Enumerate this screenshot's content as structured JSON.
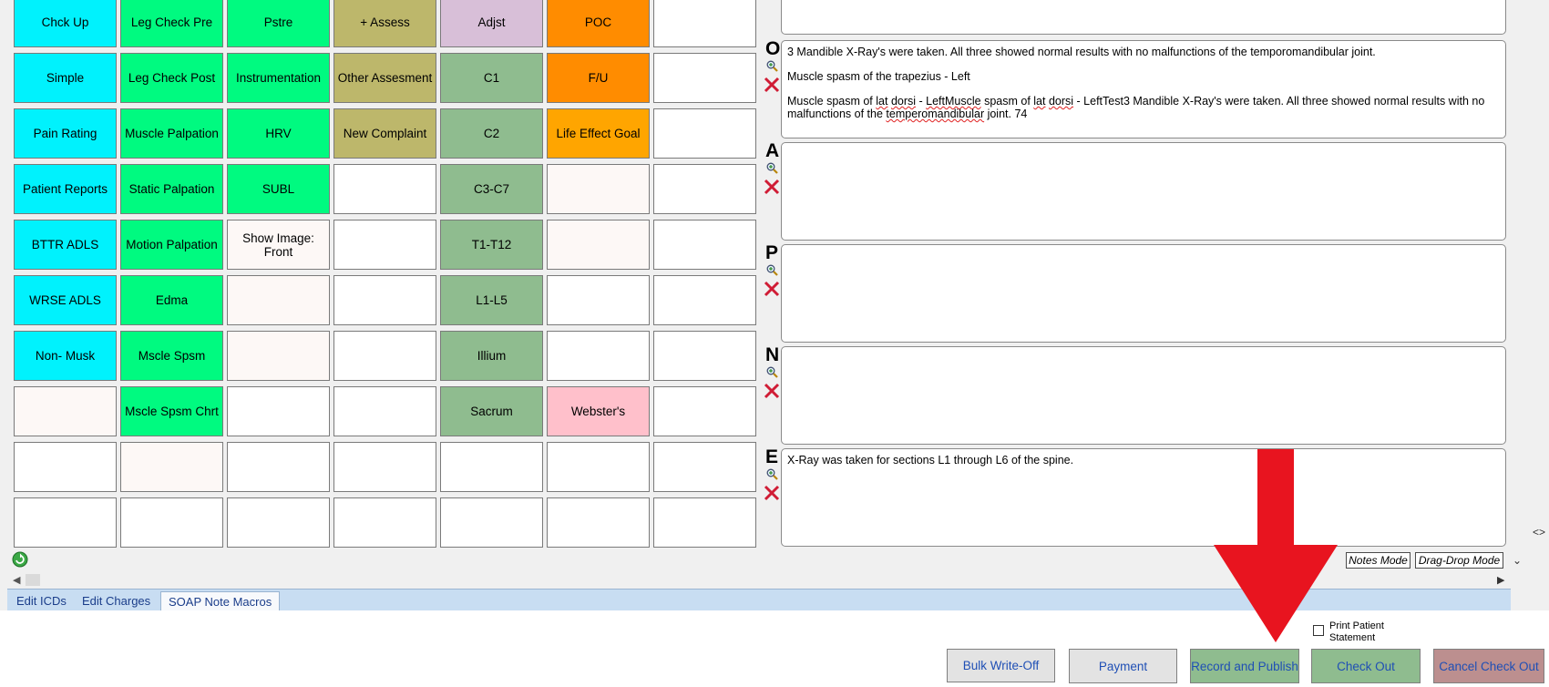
{
  "macro_grid": {
    "rows": [
      [
        {
          "label": "Chck Up",
          "color": "cyan"
        },
        {
          "label": "Leg Check Pre",
          "color": "green"
        },
        {
          "label": "Pstre",
          "color": "green"
        },
        {
          "label": "+ Assess",
          "color": "olive"
        },
        {
          "label": "Adjst",
          "color": "lilac"
        },
        {
          "label": "POC",
          "color": "orange"
        },
        {
          "label": "",
          "color": "white"
        }
      ],
      [
        {
          "label": "Simple",
          "color": "cyan"
        },
        {
          "label": "Leg Check Post",
          "color": "green"
        },
        {
          "label": "Instrumentation",
          "color": "green"
        },
        {
          "label": "Other Assesment",
          "color": "olive"
        },
        {
          "label": "C1",
          "color": "sage"
        },
        {
          "label": "F/U",
          "color": "orange"
        },
        {
          "label": "",
          "color": "white"
        }
      ],
      [
        {
          "label": "Pain Rating",
          "color": "cyan"
        },
        {
          "label": "Muscle Palpation",
          "color": "green"
        },
        {
          "label": "HRV",
          "color": "green"
        },
        {
          "label": "New Complaint",
          "color": "olive"
        },
        {
          "label": "C2",
          "color": "sage"
        },
        {
          "label": "Life Effect Goal",
          "color": "amber"
        },
        {
          "label": "",
          "color": "white"
        }
      ],
      [
        {
          "label": "Patient Reports",
          "color": "cyan"
        },
        {
          "label": "Static Palpation",
          "color": "green"
        },
        {
          "label": "SUBL",
          "color": "green"
        },
        {
          "label": "",
          "color": "white"
        },
        {
          "label": "C3-C7",
          "color": "sage"
        },
        {
          "label": "",
          "color": "snow"
        },
        {
          "label": "",
          "color": "white"
        }
      ],
      [
        {
          "label": "BTTR ADLS",
          "color": "cyan"
        },
        {
          "label": "Motion Palpation",
          "color": "green"
        },
        {
          "label": "Show Image: Front",
          "color": "snow"
        },
        {
          "label": "",
          "color": "white"
        },
        {
          "label": "T1-T12",
          "color": "sage"
        },
        {
          "label": "",
          "color": "snow"
        },
        {
          "label": "",
          "color": "white"
        }
      ],
      [
        {
          "label": "WRSE ADLS",
          "color": "cyan"
        },
        {
          "label": "Edma",
          "color": "green"
        },
        {
          "label": "",
          "color": "snow"
        },
        {
          "label": "",
          "color": "white"
        },
        {
          "label": "L1-L5",
          "color": "sage"
        },
        {
          "label": "",
          "color": "white"
        },
        {
          "label": "",
          "color": "white"
        }
      ],
      [
        {
          "label": "Non- Musk",
          "color": "cyan"
        },
        {
          "label": "Mscle Spsm",
          "color": "green"
        },
        {
          "label": "",
          "color": "snow"
        },
        {
          "label": "",
          "color": "white"
        },
        {
          "label": "Illium",
          "color": "sage"
        },
        {
          "label": "",
          "color": "white"
        },
        {
          "label": "",
          "color": "white"
        }
      ],
      [
        {
          "label": "",
          "color": "snow"
        },
        {
          "label": "Mscle Spsm Chrt",
          "color": "green"
        },
        {
          "label": "",
          "color": "white"
        },
        {
          "label": "",
          "color": "white"
        },
        {
          "label": "Sacrum",
          "color": "sage"
        },
        {
          "label": "Webster's",
          "color": "pink"
        },
        {
          "label": "",
          "color": "white"
        }
      ],
      [
        {
          "label": "",
          "color": "white"
        },
        {
          "label": "",
          "color": "snow"
        },
        {
          "label": "",
          "color": "white"
        },
        {
          "label": "",
          "color": "white"
        },
        {
          "label": "",
          "color": "white"
        },
        {
          "label": "",
          "color": "white"
        },
        {
          "label": "",
          "color": "white"
        }
      ],
      [
        {
          "label": "",
          "color": "white"
        },
        {
          "label": "",
          "color": "white"
        },
        {
          "label": "",
          "color": "white"
        },
        {
          "label": "",
          "color": "white"
        },
        {
          "label": "",
          "color": "white"
        },
        {
          "label": "",
          "color": "white"
        },
        {
          "label": "",
          "color": "white"
        }
      ]
    ]
  },
  "soap": {
    "o": {
      "letter": "O",
      "line1": "3 Mandible X-Ray's were taken. All three showed normal results with no malfunctions of the temporomandibular joint.",
      "line2": "Muscle spasm of the trapezius - Left",
      "line3_a": "Muscle spasm of ",
      "line3_b": "lat",
      "line3_c": " ",
      "line3_d": "dorsi",
      "line3_e": " - ",
      "line3_f": "LeftMuscle",
      "line3_g": " spasm of ",
      "line3_h": "lat",
      "line3_i": " ",
      "line3_j": "dorsi",
      "line3_k": " - LeftTest3 Mandible X-Ray's were taken. All three showed normal results with no malfunctions of the ",
      "line3_l": "temperomandibular",
      "line3_m": " joint. 74"
    },
    "a": {
      "letter": "A"
    },
    "p": {
      "letter": "P"
    },
    "n": {
      "letter": "N"
    },
    "e": {
      "letter": "E",
      "text": "X-Ray was taken for sections L1 through L6 of the spine."
    }
  },
  "mode_buttons": {
    "notes": "Notes Mode",
    "drag_drop": "Drag-Drop Mode"
  },
  "tabs": {
    "edit_icds": "Edit ICDs",
    "edit_charges": "Edit Charges",
    "soap_note_macros": "SOAP Note Macros"
  },
  "print_statement": {
    "label_line1": "Print Patient",
    "label_line2": "Statement",
    "checked": false
  },
  "actions": {
    "bulk_write_off": "Bulk Write-Off",
    "payment": "Payment",
    "record_and_publish": "Record and Publish",
    "check_out": "Check Out",
    "cancel_check_out": "Cancel Check Out"
  },
  "colors": {
    "cyan": "#00f2fd",
    "green": "#00fa80",
    "olive": "#bdb76b",
    "lilac": "#d8bfd8",
    "orange": "#ff8c00",
    "amber": "#ffa500",
    "sage": "#8fbc8f",
    "pink": "#ffc0cb",
    "annotation_arrow": "#e8141f",
    "record_button": "#8fbc8f",
    "check_out_button": "#8fbc8f",
    "cancel_button": "#bc8f8f"
  },
  "icons": {
    "zoom": "magnifier-plus-icon",
    "delete": "red-x-icon",
    "refresh": "green-refresh-icon",
    "annotation": "red-down-arrow"
  }
}
